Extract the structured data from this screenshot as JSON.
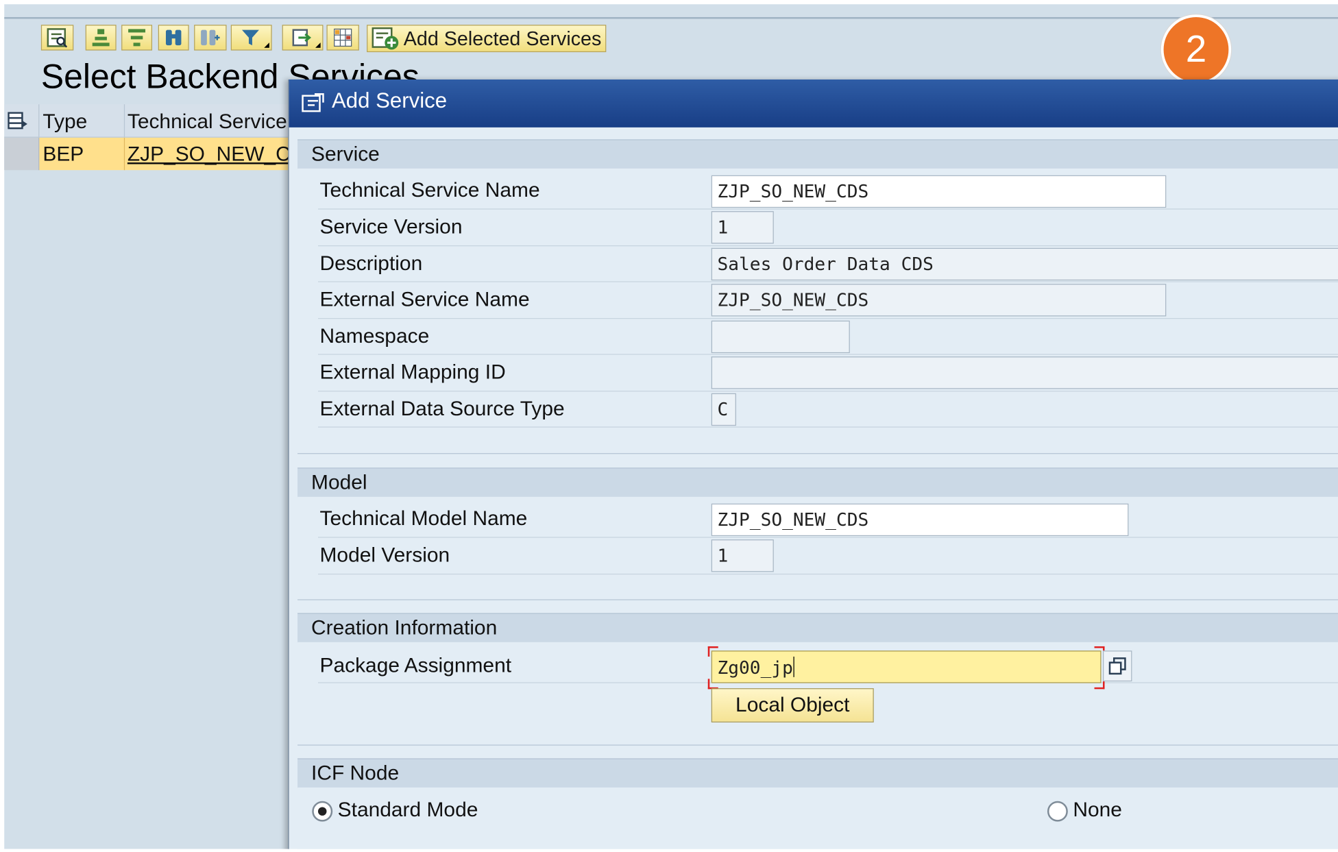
{
  "toolbar": {
    "add_selected_label": "Add Selected Services",
    "icons": [
      "details-icon",
      "align-icon",
      "filter-rows-icon",
      "binoculars-icon",
      "find-next-icon",
      "filter-icon",
      "export-icon",
      "layout-grid-icon"
    ]
  },
  "page": {
    "title": "Select Backend Services",
    "step_badge": "2"
  },
  "grid": {
    "columns": [
      "Type",
      "Technical Service"
    ],
    "rows": [
      {
        "type": "BEP",
        "technical_service": "ZJP_SO_NEW_CD"
      }
    ]
  },
  "dialog": {
    "title": "Add Service",
    "service": {
      "heading": "Service",
      "technical_service_name_label": "Technical Service Name",
      "technical_service_name": "ZJP_SO_NEW_CDS",
      "service_version_label": "Service Version",
      "service_version": "1",
      "description_label": "Description",
      "description": "Sales Order Data CDS",
      "external_service_name_label": "External Service Name",
      "external_service_name": "ZJP_SO_NEW_CDS",
      "namespace_label": "Namespace",
      "namespace": "",
      "external_mapping_id_label": "External Mapping ID",
      "external_mapping_id": "",
      "external_data_source_type_label": "External Data Source Type",
      "external_data_source_type": "C"
    },
    "model": {
      "heading": "Model",
      "technical_model_name_label": "Technical Model Name",
      "technical_model_name": "ZJP_SO_NEW_CDS",
      "model_version_label": "Model Version",
      "model_version": "1"
    },
    "creation": {
      "heading": "Creation Information",
      "package_assignment_label": "Package Assignment",
      "package_assignment": "Zg00_jp",
      "local_object_label": "Local Object"
    },
    "icf": {
      "heading": "ICF Node",
      "standard_mode_label": "Standard Mode",
      "standard_mode_selected": true,
      "none_label": "None",
      "none_selected": false
    }
  },
  "colors": {
    "background": "#d2dfe9",
    "dialog_title_bar": "#183e86",
    "selected_row": "#ffe08c",
    "focused_input": "#fff1a0",
    "badge": "#ee7527"
  }
}
